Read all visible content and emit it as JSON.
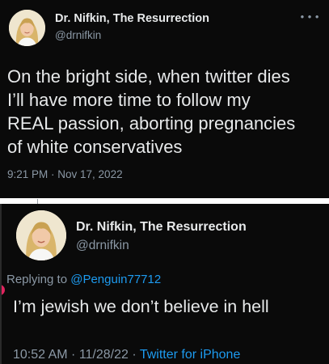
{
  "tweet": {
    "author": {
      "name": "Dr. Nifkin, The Resurrection",
      "handle": "@drnifkin",
      "avatar_icon": "profile-photo-blonde-woman"
    },
    "text_lines": [
      "On the bright side, when twitter dies",
      "I’ll have more time to follow my",
      "REAL passion, aborting pregnancies",
      "of white conservatives"
    ],
    "timestamp": "9:21 PM · Nov 17, 2022",
    "more_icon": "ellipsis-icon"
  },
  "reply": {
    "author": {
      "name": "Dr. Nifkin, The Resurrection",
      "handle": "@drnifkin",
      "avatar_icon": "profile-photo-blonde-woman"
    },
    "replying_prefix": "Replying to ",
    "replying_to": "@Penguin77712",
    "text": "I’m jewish we don’t believe in hell",
    "timestamp": "10:52 AM · 11/28/22 · ",
    "source": "Twitter for iPhone"
  },
  "colors": {
    "background": "#0a0a0a",
    "text": "#e7e9ea",
    "secondary_text": "#8b98a5",
    "accent": "#1d9bf0"
  }
}
